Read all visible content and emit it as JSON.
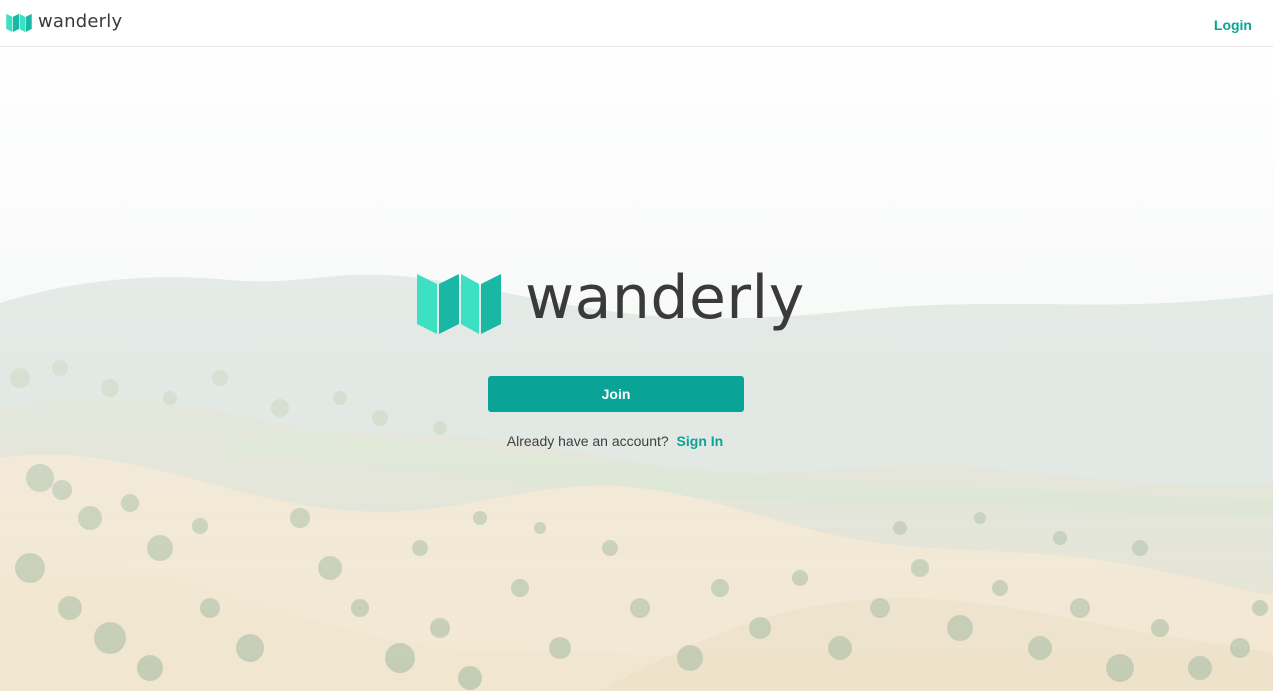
{
  "header": {
    "brand_name": "wanderly",
    "login_label": "Login"
  },
  "hero": {
    "brand_name": "wanderly",
    "join_label": "Join",
    "signin_prompt": "Already have an account?",
    "signin_label": "Sign In"
  },
  "colors": {
    "accent": "#0aa497",
    "logo_light": "#3ee0c4",
    "logo_dark": "#18b8a4",
    "text_dark": "#3a3a3a"
  },
  "icons": {
    "brand_logo": "folded-map-icon"
  }
}
